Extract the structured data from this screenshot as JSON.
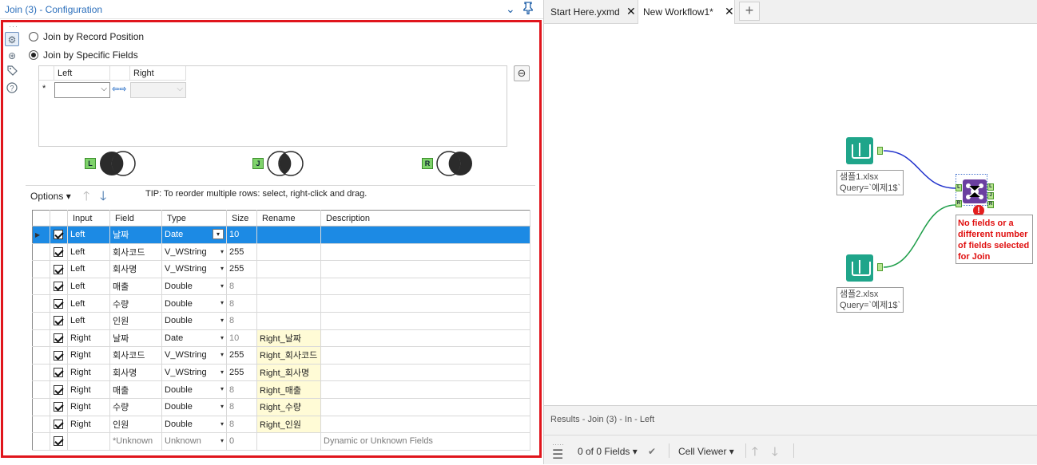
{
  "config": {
    "title": "Join (3) - Configuration",
    "join_by_position": "Join by Record Position",
    "join_by_fields": "Join by Specific Fields",
    "grid_left_header": "Left",
    "grid_right_header": "Right",
    "grid_star": "*",
    "swap_icon": "⇦⇨",
    "venn_labels": [
      "L",
      "J",
      "R"
    ],
    "options_label": "Options",
    "tip": "TIP: To reorder multiple rows: select, right-click and drag."
  },
  "table": {
    "headers": [
      "Input",
      "Field",
      "Type",
      "Size",
      "Rename",
      "Description"
    ],
    "rows": [
      {
        "input": "Left",
        "field": "날짜",
        "type": "Date",
        "size": "10",
        "rename": "",
        "desc": ""
      },
      {
        "input": "Left",
        "field": "회사코드",
        "type": "V_WString",
        "size": "255",
        "rename": "",
        "desc": ""
      },
      {
        "input": "Left",
        "field": "회사명",
        "type": "V_WString",
        "size": "255",
        "rename": "",
        "desc": ""
      },
      {
        "input": "Left",
        "field": "매출",
        "type": "Double",
        "size": "8",
        "rename": "",
        "desc": ""
      },
      {
        "input": "Left",
        "field": "수량",
        "type": "Double",
        "size": "8",
        "rename": "",
        "desc": ""
      },
      {
        "input": "Left",
        "field": "인원",
        "type": "Double",
        "size": "8",
        "rename": "",
        "desc": ""
      },
      {
        "input": "Right",
        "field": "날짜",
        "type": "Date",
        "size": "10",
        "rename": "Right_날짜",
        "desc": ""
      },
      {
        "input": "Right",
        "field": "회사코드",
        "type": "V_WString",
        "size": "255",
        "rename": "Right_회사코드",
        "desc": ""
      },
      {
        "input": "Right",
        "field": "회사명",
        "type": "V_WString",
        "size": "255",
        "rename": "Right_회사명",
        "desc": ""
      },
      {
        "input": "Right",
        "field": "매출",
        "type": "Double",
        "size": "8",
        "rename": "Right_매출",
        "desc": ""
      },
      {
        "input": "Right",
        "field": "수량",
        "type": "Double",
        "size": "8",
        "rename": "Right_수량",
        "desc": ""
      },
      {
        "input": "Right",
        "field": "인원",
        "type": "Double",
        "size": "8",
        "rename": "Right_인원",
        "desc": ""
      },
      {
        "input": "",
        "field": "*Unknown",
        "type": "Unknown",
        "size": "0",
        "rename": "",
        "desc": "Dynamic or Unknown Fields"
      }
    ]
  },
  "tabs": {
    "tab1": "Start Here.yxmd",
    "tab2": "New Workflow1*",
    "close": "✕",
    "add": "+"
  },
  "canvas": {
    "input1_label_line1": "샘플1.xlsx",
    "input1_label_line2": "Query=`예제1$`",
    "input2_label_line1": "샘플2.xlsx",
    "input2_label_line2": "Query=`예제1$`",
    "join_anchor_in": [
      "L",
      "R"
    ],
    "join_anchor_out": [
      "L",
      "J",
      "R"
    ],
    "error_mark": "!",
    "error_message": "No fields or a different number of fields selected for Join"
  },
  "results": {
    "title": "Results - Join (3) - In - Left",
    "fields_count": "0 of 0 Fields",
    "cell_viewer": "Cell Viewer"
  }
}
